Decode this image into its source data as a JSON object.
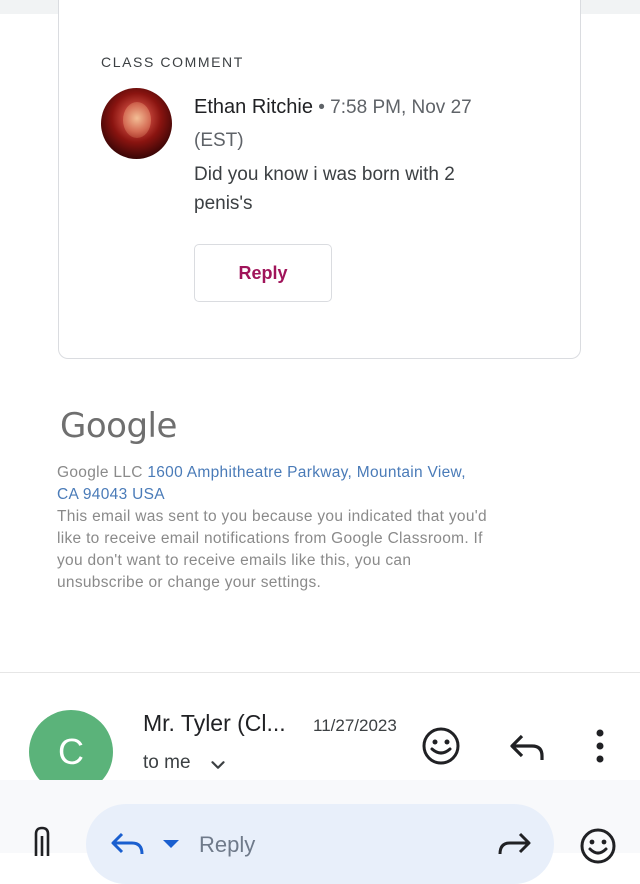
{
  "card": {
    "section_label": "CLASS COMMENT",
    "author_name": "Ethan Ritchie",
    "meta": "• 7:58 PM, Nov 27 (EST)",
    "comment": "Did you know i was born with 2 penis's",
    "reply_label": "Reply"
  },
  "footer": {
    "logo": "Google",
    "company": "Google LLC ",
    "address": "1600 Amphitheatre Parkway, Mountain View, CA 94043 USA",
    "notice": "This email was sent to you because you indicated that you'd like to receive email notifications from Google Classroom. If you don't want to receive emails like this, you can unsubscribe or change your settings."
  },
  "message": {
    "avatar_letter": "C",
    "avatar_color": "#5bb37a",
    "sender": "Mr. Tyler (Cl...",
    "date": "11/27/2023",
    "recipient": "to me"
  },
  "compose": {
    "placeholder": "Reply"
  }
}
